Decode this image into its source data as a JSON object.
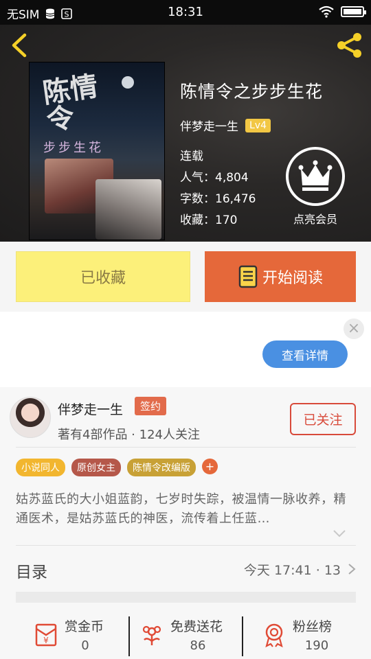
{
  "status_bar": {
    "carrier": "无SIM",
    "time": "18:31"
  },
  "book": {
    "title": "陈情令之步步生花",
    "author": "伴梦走一生",
    "author_level": "Lv4",
    "status": "连载",
    "popularity_label": "人气",
    "popularity": "4,804",
    "word_count_label": "字数",
    "word_count": "16,476",
    "favorites_label": "收藏",
    "favorites": "170",
    "cover_title": "陈情令",
    "cover_subtitle": "步步生花"
  },
  "vip": {
    "label": "点亮会员"
  },
  "actions": {
    "favorited_label": "已收藏",
    "read_label": "开始阅读"
  },
  "ad": {
    "detail_label": "查看详情",
    "close_symbol": "×"
  },
  "author_card": {
    "name": "伴梦走一生",
    "sign_badge": "签约",
    "meta": "著有4部作品 · 124人关注",
    "follow_label": "已关注"
  },
  "tags": [
    {
      "label": "小说同人",
      "color": "#f2b62f"
    },
    {
      "label": "原创女主",
      "color": "#b5584a"
    },
    {
      "label": "陈情令改编版",
      "color": "#c8a136"
    }
  ],
  "tag_add_symbol": "+",
  "description": "姑苏蓝氏的大小姐蓝韵，七岁时失踪，被温情一脉收养，精通医术，是姑苏蓝氏的神医，流传着上任蓝…",
  "toc": {
    "title": "目录",
    "update": "今天 17:41 · 13"
  },
  "bottom_stats": [
    {
      "name": "赏金币",
      "value": "0",
      "icon": "red-envelope-icon"
    },
    {
      "name": "免费送花",
      "value": "86",
      "icon": "flower-icon"
    },
    {
      "name": "粉丝榜",
      "value": "190",
      "icon": "medal-icon"
    }
  ],
  "colors": {
    "accent_orange": "#e5683a",
    "favorite_yellow": "#fcf07a",
    "follow_red": "#d84a3a",
    "ad_button_blue": "#4a90e2",
    "icon_gold": "#f5d028"
  }
}
